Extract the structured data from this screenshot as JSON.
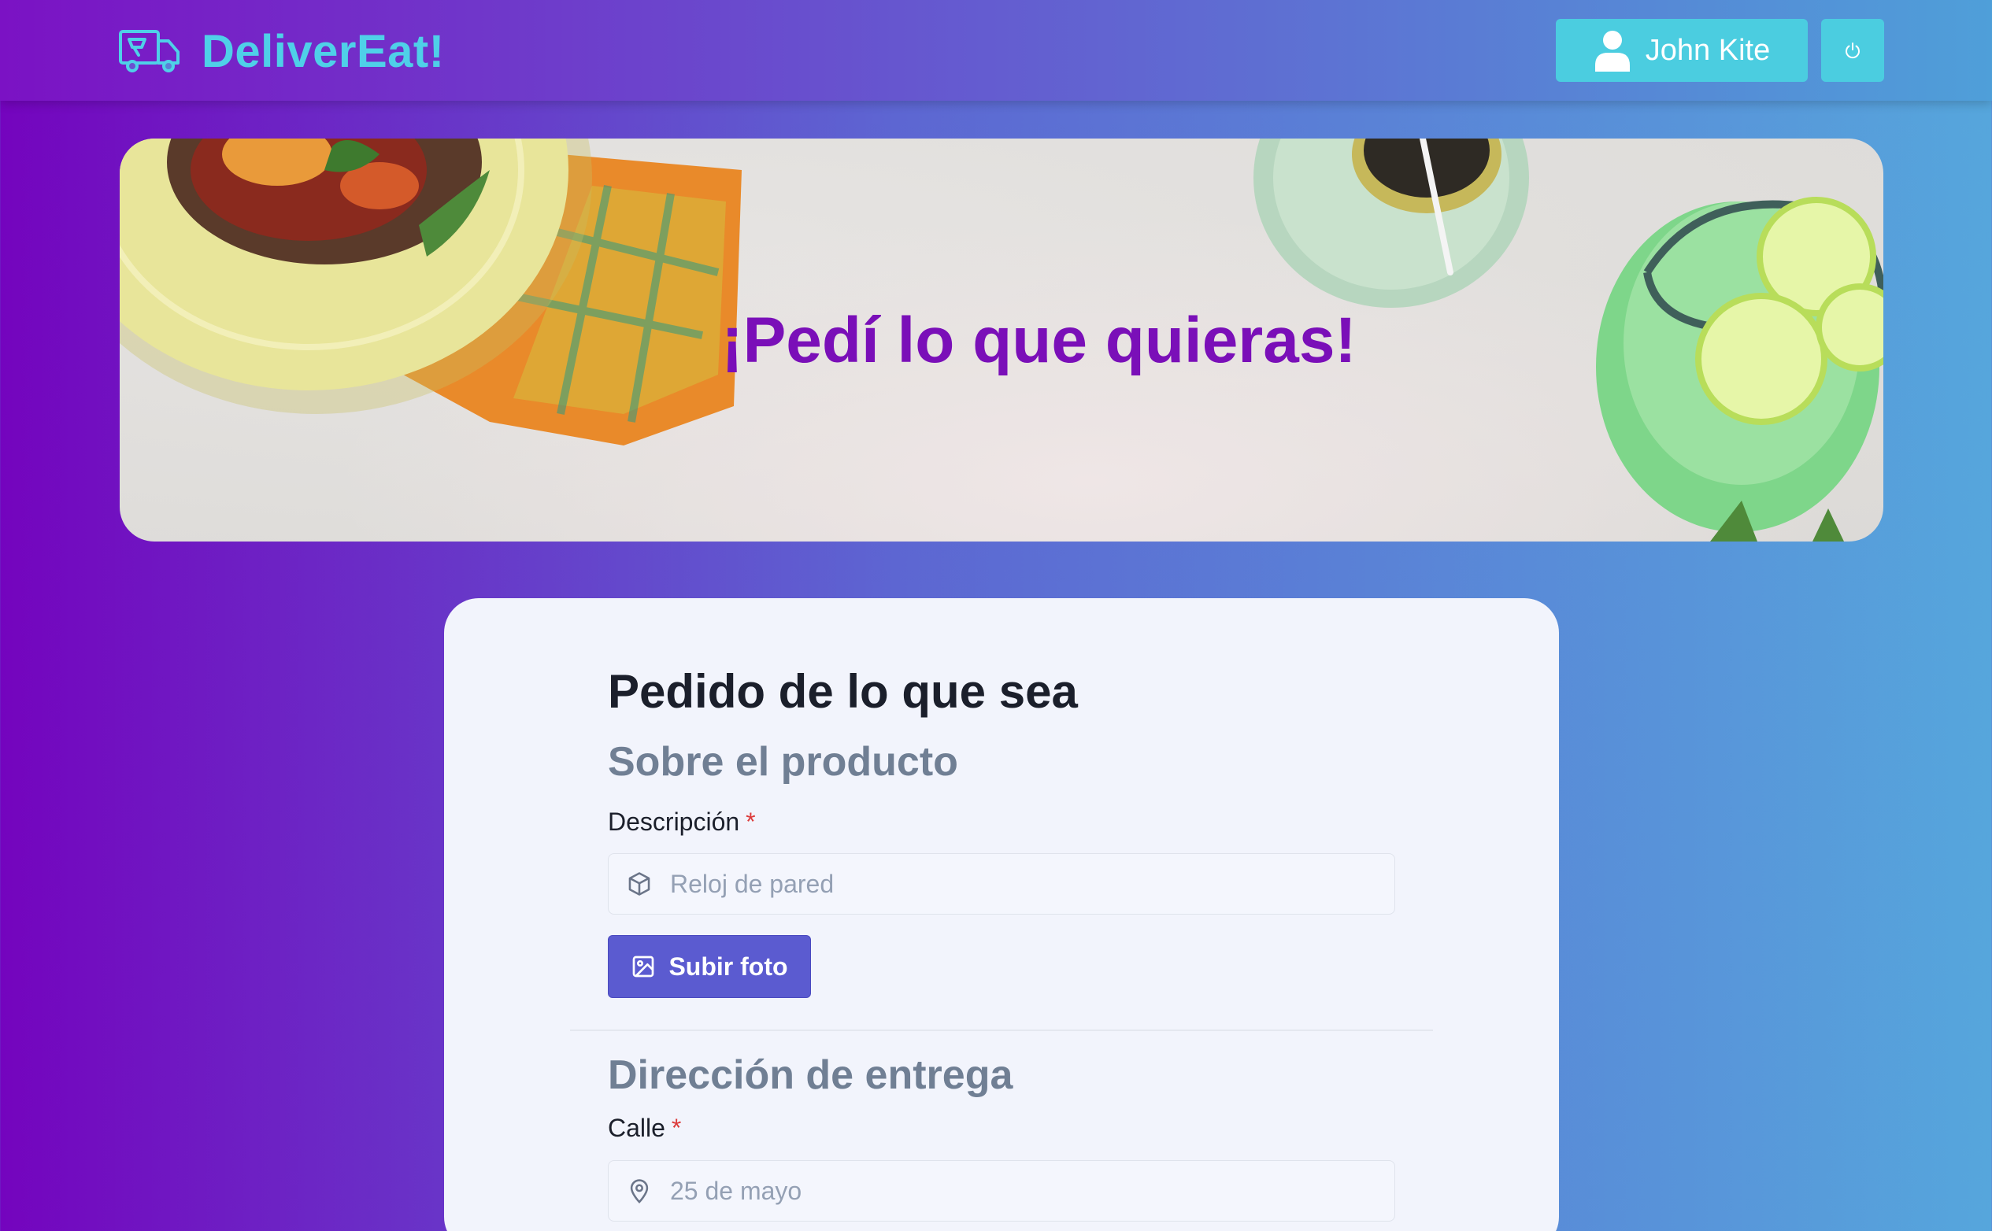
{
  "navbar": {
    "brand_name": "DeliverEat!",
    "brand_icon": "delivery-truck-icon",
    "user_name": "John Kite",
    "user_icon": "user-icon",
    "power_icon": "power-icon"
  },
  "hero": {
    "title": "¡Pedí lo que quieras!"
  },
  "form": {
    "title": "Pedido de lo que sea",
    "product_section": {
      "title": "Sobre el producto",
      "description_label": "Descripción",
      "required_mark": "*",
      "description_placeholder": "Reloj de pared",
      "description_icon": "box-icon",
      "upload_label": "Subir foto",
      "upload_icon": "image-icon"
    },
    "delivery_section": {
      "title": "Dirección de entrega",
      "street_label": "Calle",
      "required_mark": "*",
      "street_placeholder": "25 de mayo",
      "street_icon": "map-pin-icon"
    }
  },
  "colors": {
    "brand": "#4fd0e8",
    "accent_button": "#4bcde0",
    "primary_button": "#5b5bd0",
    "hero_title": "#7a0fb8",
    "required": "#dc3b3b",
    "section_title": "#707f94"
  }
}
